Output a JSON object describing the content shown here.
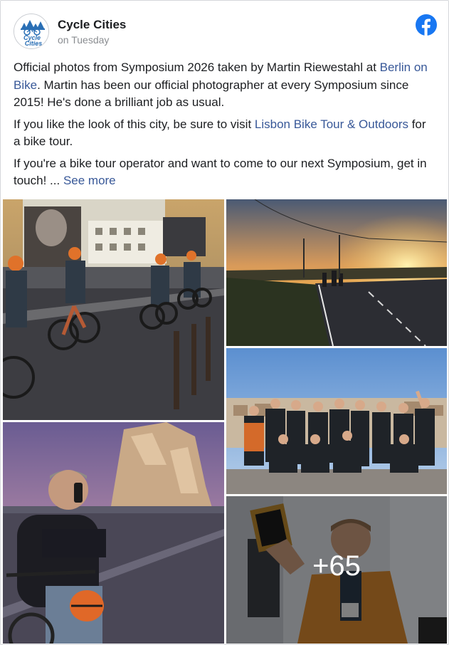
{
  "post": {
    "page_name": "Cycle Cities",
    "time": "on Tuesday",
    "avatar_text_1": "Cycle",
    "avatar_text_2": "Cities",
    "paragraphs": [
      {
        "before": "Official photos from Symposium 2026 taken by Martin Riewestahl at ",
        "link": "Berlin on Bike",
        "after": ". Martin has been our official photographer at every Symposium since 2015! He's done a brilliant job as usual."
      },
      {
        "before": "If you like the look of this city, be sure to visit ",
        "link": "Lisbon Bike Tour & Outdoors",
        "after": " for a bike tour."
      },
      {
        "before": "If you're a bike tour operator and want to come to our next Symposium, get in touch! ... ",
        "link": "See more",
        "after": ""
      }
    ]
  },
  "photos": {
    "more_count": "+65"
  },
  "colors": {
    "link": "#385898",
    "facebook_blue": "#1877f2",
    "meta_gray": "#8a8d91"
  }
}
